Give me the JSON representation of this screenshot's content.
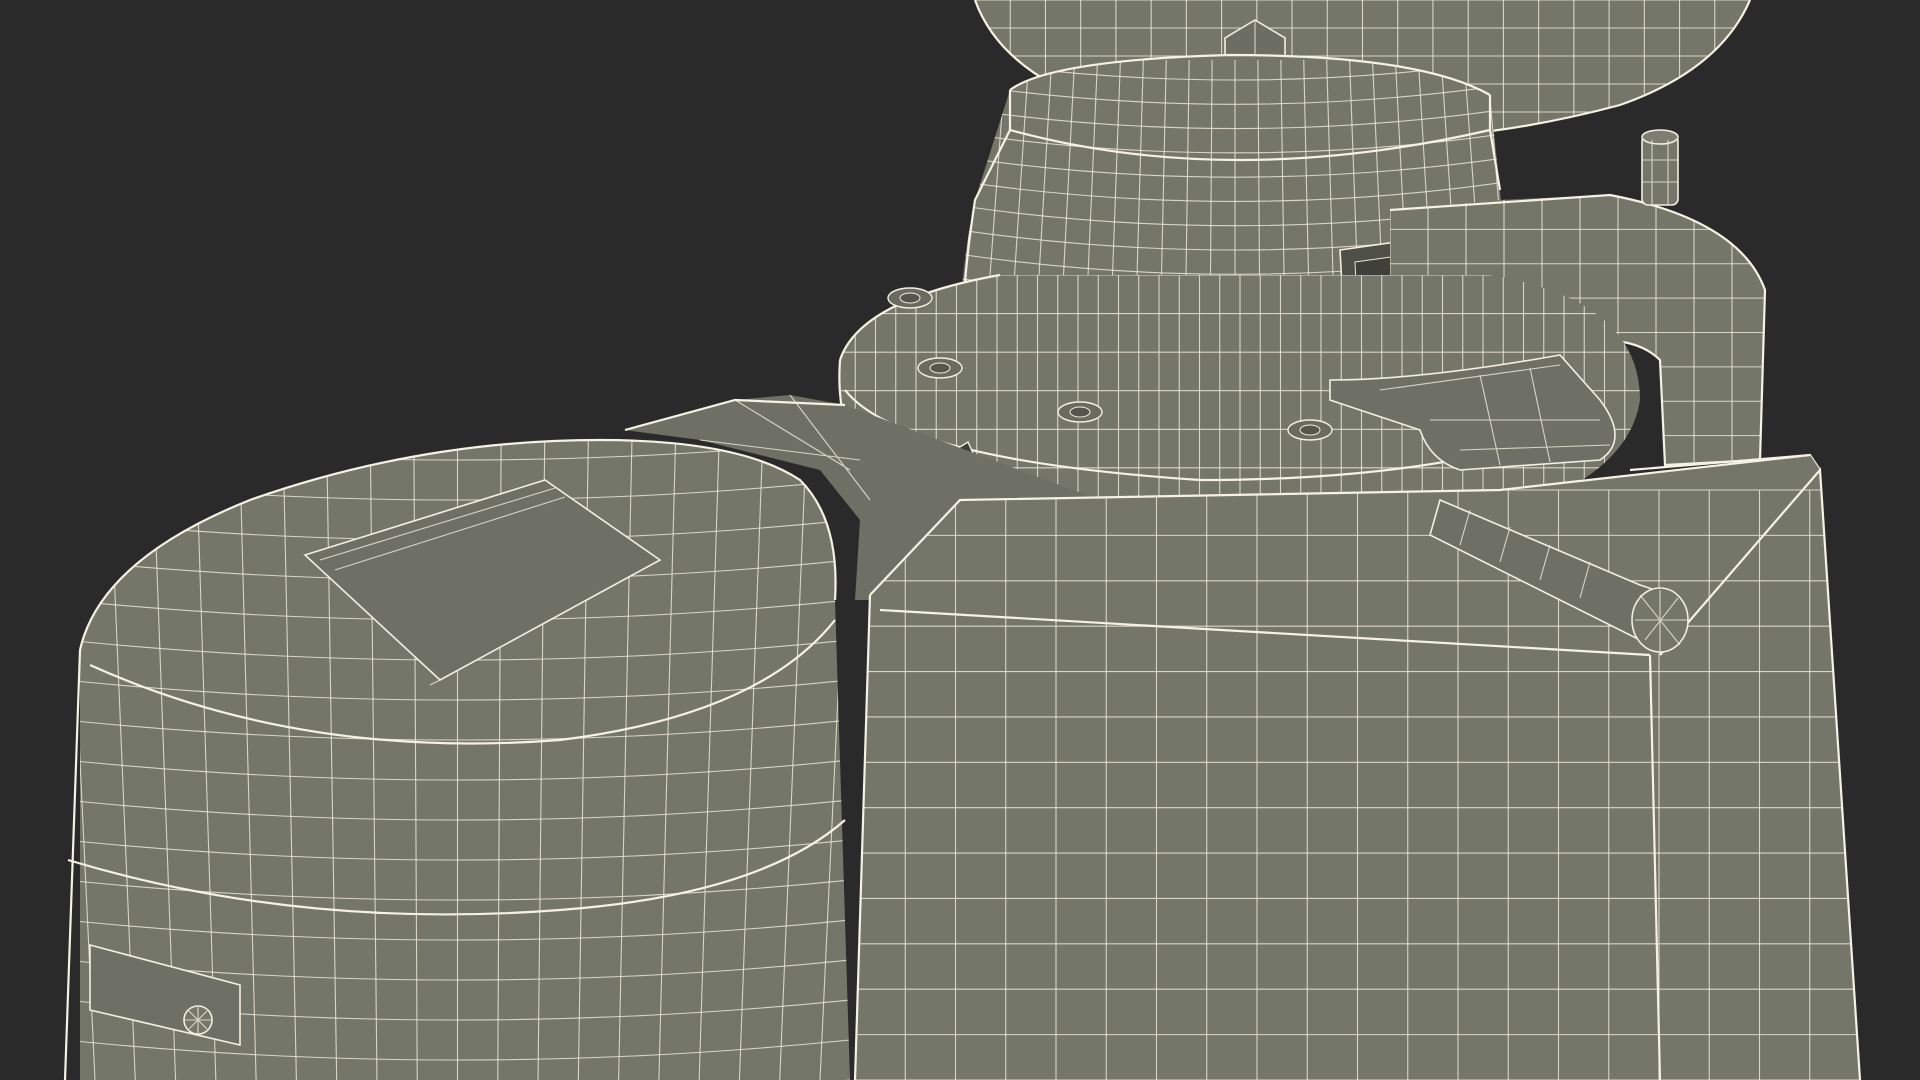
{
  "scene": {
    "background_color": "#2a2a2a",
    "surface_color": "#75766a",
    "surface_shadow_color": "#5f6056",
    "wire_color": "#eae6d4"
  }
}
